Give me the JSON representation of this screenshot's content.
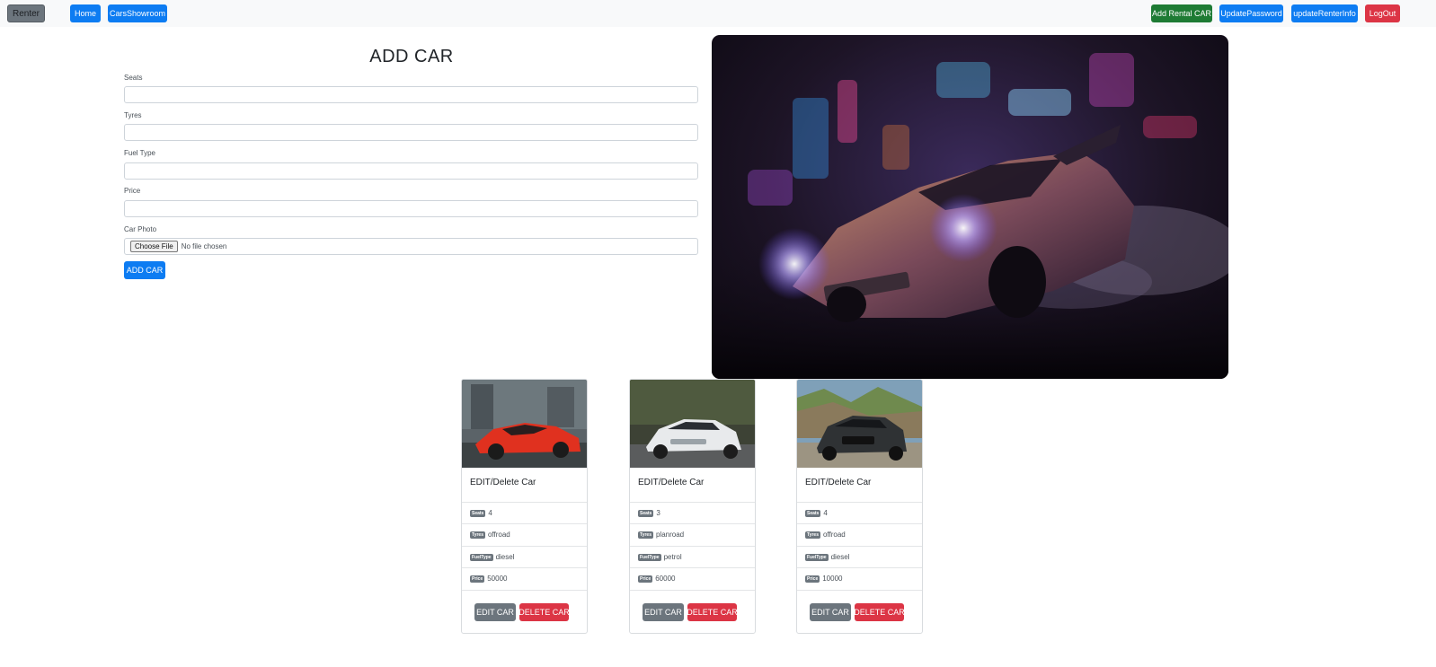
{
  "navbar": {
    "brand": "Renter",
    "links": [
      "Home",
      "CarsShowroom"
    ],
    "right": {
      "add_rental": "Add Rental CAR",
      "update_password": "UpdatePassword",
      "update_info": "updateRenterInfo",
      "logout": "LogOut"
    }
  },
  "form": {
    "title": "ADD CAR",
    "fields": {
      "seats": "Seats",
      "tyres": "Tyres",
      "fuel_type": "Fuel Type",
      "price": "Price",
      "photo": "Car Photo"
    },
    "file_button": "Choose File",
    "file_status": "No file chosen",
    "submit": "ADD CAR"
  },
  "cards": [
    {
      "title": "EDIT/Delete Car",
      "seats": "4",
      "tyres": "offroad",
      "fuel": "diesel",
      "price": "50000"
    },
    {
      "title": "EDIT/Delete Car",
      "seats": "3",
      "tyres": "planroad",
      "fuel": "petrol",
      "price": "60000"
    },
    {
      "title": "EDIT/Delete Car",
      "seats": "4",
      "tyres": "offroad",
      "fuel": "diesel",
      "price": "10000"
    }
  ],
  "badges": {
    "seats": "Seats",
    "tyres": "Tyres",
    "fuel": "FuelType",
    "price": "Price"
  },
  "card_buttons": {
    "edit": "EDIT CAR",
    "delete": "DELETE CAR"
  },
  "colors": {
    "primary": "#0d7cf2",
    "success": "#1e7b34",
    "danger": "#dc3545",
    "secondary": "#6c757d"
  }
}
